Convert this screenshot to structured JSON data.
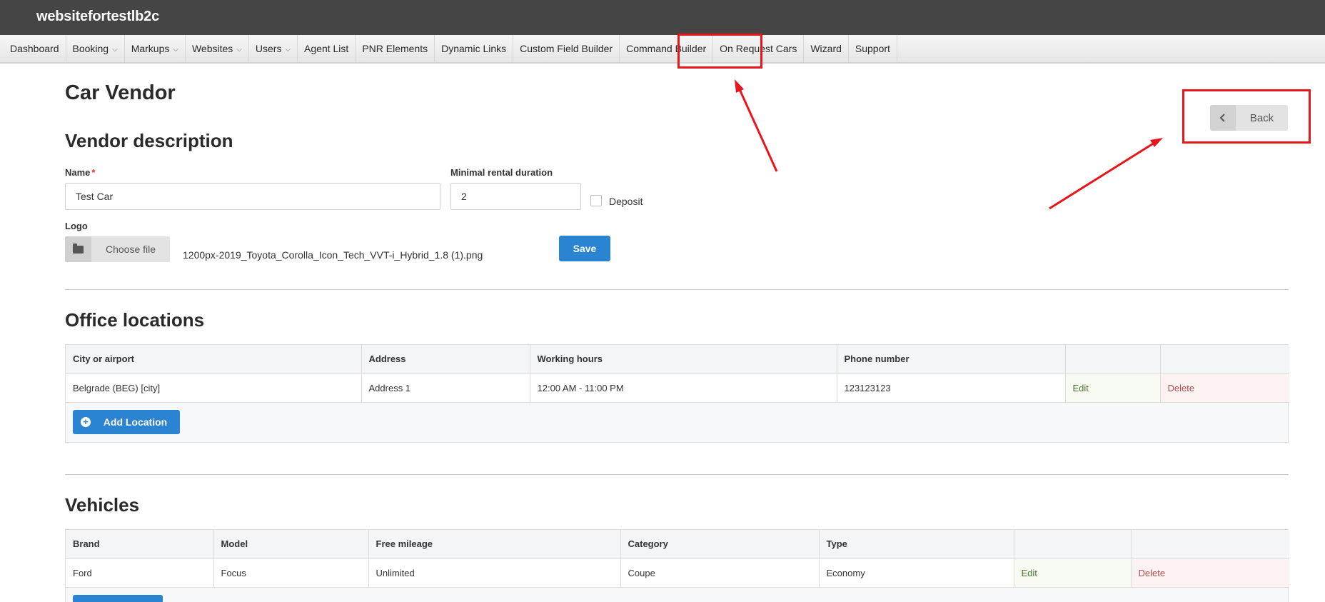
{
  "app": {
    "site_title": "websitefortestlb2c"
  },
  "nav": {
    "items": [
      {
        "label": "Dashboard",
        "dropdown": false
      },
      {
        "label": "Booking",
        "dropdown": true
      },
      {
        "label": "Markups",
        "dropdown": true
      },
      {
        "label": "Websites",
        "dropdown": true
      },
      {
        "label": "Users",
        "dropdown": true
      },
      {
        "label": "Agent List",
        "dropdown": false
      },
      {
        "label": "PNR Elements",
        "dropdown": false
      },
      {
        "label": "Dynamic Links",
        "dropdown": false
      },
      {
        "label": "Custom Field Builder",
        "dropdown": false
      },
      {
        "label": "Command Builder",
        "dropdown": false
      },
      {
        "label": "On Request Cars",
        "dropdown": false
      },
      {
        "label": "Wizard",
        "dropdown": false
      },
      {
        "label": "Support",
        "dropdown": false
      }
    ],
    "dropdown_icon": "chevron-down-icon"
  },
  "page": {
    "title": "Car Vendor",
    "back_label": "Back",
    "back_icon": "chevron-left-icon"
  },
  "vendor": {
    "section_title": "Vendor description",
    "name_label": "Name",
    "required_mark": "*",
    "name_value": "Test Car",
    "min_duration_label": "Minimal rental duration",
    "min_duration_value": "2",
    "deposit_label": "Deposit",
    "deposit_checked": false,
    "logo_label": "Logo",
    "choose_file_label": "Choose file",
    "file_name": "1200px-2019_Toyota_Corolla_Icon_Tech_VVT-i_Hybrid_1.8 (1).png",
    "save_label": "Save"
  },
  "offices": {
    "section_title": "Office locations",
    "columns": [
      "City or airport",
      "Address",
      "Working hours",
      "Phone number",
      "",
      ""
    ],
    "rows": [
      {
        "city": "Belgrade (BEG) [city]",
        "address": "Address 1",
        "hours": "12:00 AM - 11:00 PM",
        "phone": "123123123",
        "edit": "Edit",
        "delete": "Delete"
      }
    ],
    "add_label": "Add Location"
  },
  "vehicles": {
    "section_title": "Vehicles",
    "columns": [
      "Brand",
      "Model",
      "Free mileage",
      "Category",
      "Type",
      "",
      ""
    ],
    "rows": [
      {
        "brand": "Ford",
        "model": "Focus",
        "mileage": "Unlimited",
        "category": "Coupe",
        "type": "Economy",
        "edit": "Edit",
        "delete": "Delete"
      }
    ]
  },
  "colors": {
    "topbar": "#454545",
    "primary": "#2a84d2",
    "annotation": "#e8161b",
    "edit_text": "#4b7a2f",
    "delete_text": "#b24c4c"
  }
}
